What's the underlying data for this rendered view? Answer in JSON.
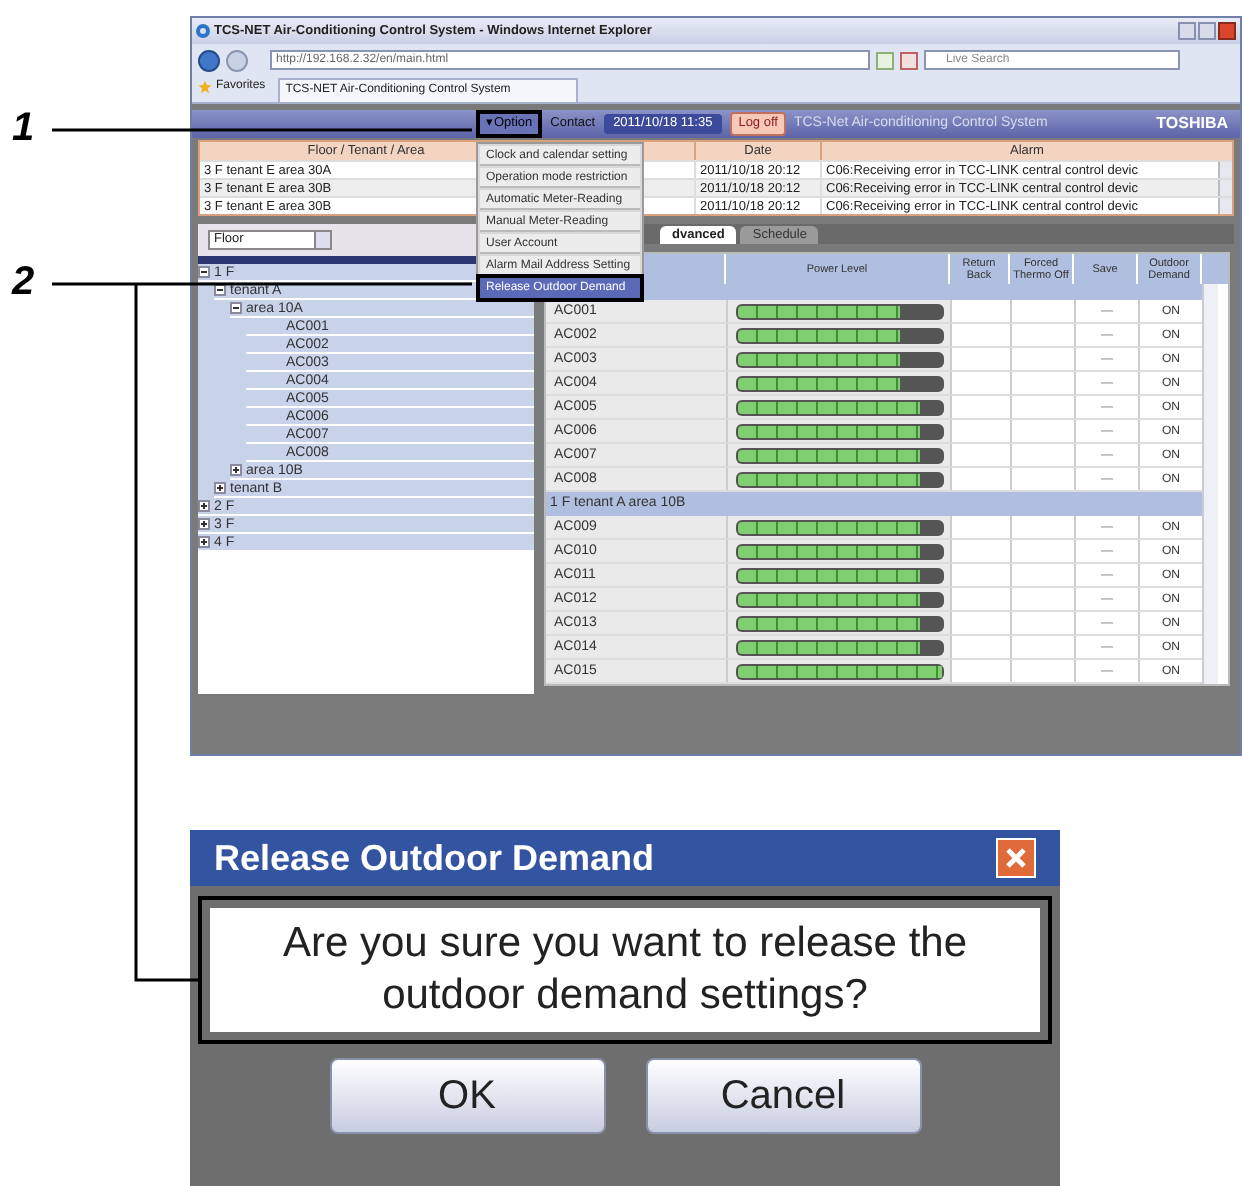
{
  "callouts": [
    {
      "number": "1"
    },
    {
      "number": "2"
    }
  ],
  "browser": {
    "title": "TCS-NET Air-Conditioning Control System - Windows Internet Explorer",
    "url": "http://192.168.2.32/en/main.html",
    "search_placeholder": "Live Search",
    "favorites": "Favorites",
    "tab": "TCS-NET Air-Conditioning Control System"
  },
  "header": {
    "option": "▾Option",
    "contact": "Contact",
    "datetime": "2011/10/18 11:35",
    "logoff": "Log off",
    "system_title": "TCS-Net Air-conditioning Control System",
    "brand": "TOSHIBA"
  },
  "option_menu": [
    {
      "label": "Clock and calendar setting",
      "selected": false
    },
    {
      "label": "Operation mode restriction",
      "selected": false
    },
    {
      "label": "Automatic Meter-Reading",
      "selected": false
    },
    {
      "label": "Manual Meter-Reading",
      "selected": false
    },
    {
      "label": "User Account",
      "selected": false
    },
    {
      "label": "Alarm Mail Address Setting",
      "selected": false
    },
    {
      "label": "Release Outdoor Demand",
      "selected": true
    }
  ],
  "alarm_table": {
    "columns": [
      "Floor / Tenant / Area",
      "Date",
      "Alarm"
    ],
    "rows": [
      {
        "area": "3 F tenant E area 30A",
        "date": "2011/10/18 20:12",
        "alarm": "C06:Receiving error in TCC-LINK central control devic"
      },
      {
        "area": "3 F tenant E area 30B",
        "date": "2011/10/18 20:12",
        "alarm": "C06:Receiving error in TCC-LINK central control devic"
      },
      {
        "area": "3 F tenant E area 30B",
        "date": "2011/10/18 20:12",
        "alarm": "C06:Receiving error in TCC-LINK central control devic"
      }
    ]
  },
  "filter": {
    "value": "Floor"
  },
  "tree": [
    {
      "label": "1 F",
      "expanded": true,
      "children": [
        {
          "label": "tenant A",
          "expanded": true,
          "children": [
            {
              "label": "area 10A",
              "expanded": true,
              "children": [
                {
                  "label": "AC001"
                },
                {
                  "label": "AC002"
                },
                {
                  "label": "AC003"
                },
                {
                  "label": "AC004"
                },
                {
                  "label": "AC005"
                },
                {
                  "label": "AC006"
                },
                {
                  "label": "AC007"
                },
                {
                  "label": "AC008"
                }
              ]
            },
            {
              "label": "area 10B",
              "expanded": false
            }
          ]
        },
        {
          "label": "tenant B",
          "expanded": false
        }
      ]
    },
    {
      "label": "2 F",
      "expanded": false
    },
    {
      "label": "3 F",
      "expanded": false
    },
    {
      "label": "4 F",
      "expanded": false
    }
  ],
  "view_tabs": [
    {
      "label": "dvanced",
      "selected": true
    },
    {
      "label": "Schedule",
      "selected": false
    }
  ],
  "unit_table": {
    "columns": [
      "Power Level",
      "Return Back",
      "Forced Thermo Off",
      "Save",
      "Outdoor Demand"
    ],
    "rows": [
      {
        "kind": "unit",
        "name": "AC001",
        "level": 0.8,
        "save": "—",
        "outdoor": "ON"
      },
      {
        "kind": "unit",
        "name": "AC002",
        "level": 0.8,
        "save": "—",
        "outdoor": "ON"
      },
      {
        "kind": "unit",
        "name": "AC003",
        "level": 0.8,
        "save": "—",
        "outdoor": "ON"
      },
      {
        "kind": "unit",
        "name": "AC004",
        "level": 0.8,
        "save": "—",
        "outdoor": "ON"
      },
      {
        "kind": "unit",
        "name": "AC005",
        "level": 0.9,
        "save": "—",
        "outdoor": "ON"
      },
      {
        "kind": "unit",
        "name": "AC006",
        "level": 0.9,
        "save": "—",
        "outdoor": "ON"
      },
      {
        "kind": "unit",
        "name": "AC007",
        "level": 0.9,
        "save": "—",
        "outdoor": "ON"
      },
      {
        "kind": "unit",
        "name": "AC008",
        "level": 0.9,
        "save": "—",
        "outdoor": "ON"
      },
      {
        "kind": "group",
        "name": "1 F tenant A area 10B"
      },
      {
        "kind": "unit",
        "name": "AC009",
        "level": 0.9,
        "save": "—",
        "outdoor": "ON"
      },
      {
        "kind": "unit",
        "name": "AC010",
        "level": 0.9,
        "save": "—",
        "outdoor": "ON"
      },
      {
        "kind": "unit",
        "name": "AC011",
        "level": 0.9,
        "save": "—",
        "outdoor": "ON"
      },
      {
        "kind": "unit",
        "name": "AC012",
        "level": 0.9,
        "save": "—",
        "outdoor": "ON"
      },
      {
        "kind": "unit",
        "name": "AC013",
        "level": 0.9,
        "save": "—",
        "outdoor": "ON"
      },
      {
        "kind": "unit",
        "name": "AC014",
        "level": 0.9,
        "save": "—",
        "outdoor": "ON"
      },
      {
        "kind": "unit",
        "name": "AC015",
        "level": 1,
        "save": "—",
        "outdoor": "ON"
      }
    ]
  },
  "dialog": {
    "title": "Release Outdoor Demand",
    "message": "Are you sure you want to release the outdoor demand settings?",
    "buttons": [
      "OK",
      "Cancel"
    ]
  }
}
